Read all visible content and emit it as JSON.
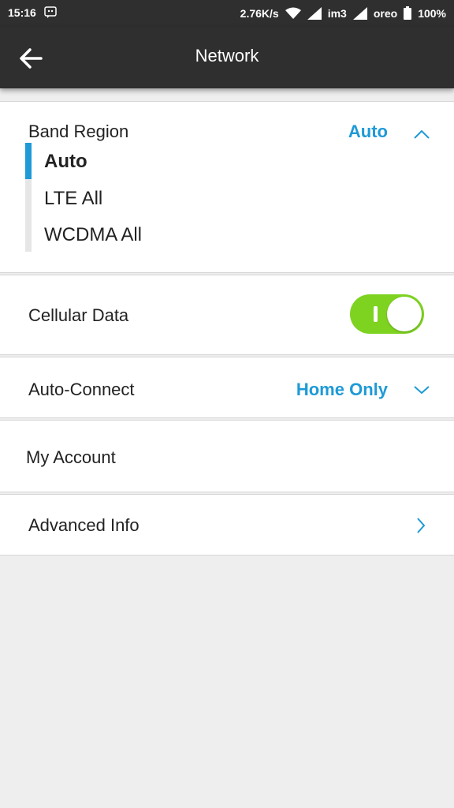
{
  "status_bar": {
    "time": "15:16",
    "net_speed": "2.76K/s",
    "carrier1": "im3",
    "carrier2": "oreo",
    "battery": "100%"
  },
  "app_bar": {
    "title": "Network",
    "back_icon": "arrow-left-icon"
  },
  "band_region": {
    "label": "Band Region",
    "value": "Auto",
    "expanded": true,
    "options": [
      "Auto",
      "LTE All",
      "WCDMA All"
    ],
    "selected_index": 0
  },
  "cellular_data": {
    "label": "Cellular Data",
    "enabled": true
  },
  "auto_connect": {
    "label": "Auto-Connect",
    "value": "Home Only"
  },
  "my_account": {
    "label": "My Account"
  },
  "advanced_info": {
    "label": "Advanced Info"
  },
  "colors": {
    "accent": "#1e9ad6",
    "toggle_on": "#7ed321",
    "bar": "#2f2f2f"
  }
}
